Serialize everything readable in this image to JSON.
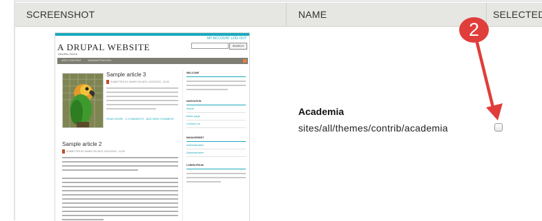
{
  "table": {
    "headers": [
      "SCREENSHOT",
      "NAME",
      "SELECTED"
    ]
  },
  "thumbnail": {
    "site_title": "A DRUPAL WEBSITE",
    "slogan": "DRUPAL ROCK",
    "search_button": "SEARCH",
    "top_links": "MY ACCOUNT   LOG OUT",
    "nav": [
      "ADD CONTENT",
      "ADMINISTRATION"
    ],
    "article1_title": "Sample article 3",
    "article1_meta": "SUBMITTED BY ADMIN ON WED, 04/22/2015 - 22:48",
    "article1_links": [
      "READ MORE",
      "2 COMMENTS",
      "ADD NEW COMMENT"
    ],
    "article2_title": "Sample article 2",
    "article2_meta": "SUBMITTED BY ADMIN ON WED, 04/22/2015 - 22:48",
    "sidebar": {
      "welcome": "WELCOME",
      "nav_heading": "NAVIGATION",
      "nav_items": [
        "Article",
        "Basic page",
        "Contact Us"
      ],
      "mgmt_heading": "MANAGEMENT",
      "mgmt_items": [
        "Administration",
        "Administrative"
      ],
      "lorem_heading": "LOREM IPSUM"
    }
  },
  "theme": {
    "name": "Academia",
    "path": "sites/all/themes/contrib/academia"
  },
  "annotation": {
    "number": "2",
    "color": "#e03e3a"
  }
}
